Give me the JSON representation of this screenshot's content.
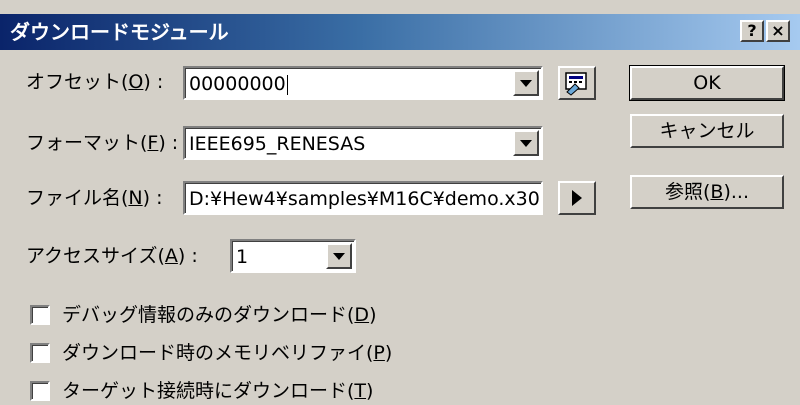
{
  "window": {
    "title": "ダウンロードモジュール",
    "help_label": "?",
    "close_label": "×"
  },
  "offset": {
    "label_prefix": "オフセット(",
    "label_key": "O",
    "label_suffix": ") :",
    "value": "00000000"
  },
  "format": {
    "label_prefix": "フォーマット(",
    "label_key": "F",
    "label_suffix": ") :",
    "value": "IEEE695_RENESAS"
  },
  "filename": {
    "label_prefix": "ファイル名(",
    "label_key": "N",
    "label_suffix": ") :",
    "value": "D:¥Hew4¥samples¥M16C¥demo.x30"
  },
  "access_size": {
    "label_prefix": "アクセスサイズ(",
    "label_key": "A",
    "label_suffix": ") :",
    "value": "1"
  },
  "buttons": {
    "ok": "OK",
    "cancel": "キャンセル",
    "browse_prefix": "参照(",
    "browse_key": "B",
    "browse_suffix": ")..."
  },
  "options": [
    {
      "prefix": "デバッグ情報のみのダウンロード(",
      "key": "D",
      "suffix": ")",
      "checked": false
    },
    {
      "prefix": "ダウンロード時のメモリベリファイ(",
      "key": "P",
      "suffix": ")",
      "checked": false
    },
    {
      "prefix": "ターゲット接続時にダウンロード(",
      "key": "T",
      "suffix": ")",
      "checked": false
    }
  ]
}
